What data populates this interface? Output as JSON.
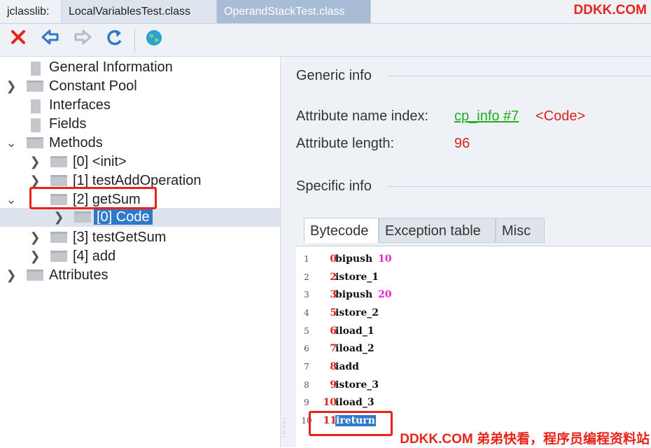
{
  "tabs": {
    "app_label": "jclasslib:",
    "items": [
      "LocalVariablesTest.class",
      "OperandStackTest.class"
    ]
  },
  "watermark_top": "DDKK.COM",
  "watermark_bottom": "DDKK.COM 弟弟快看，程序员编程资料站",
  "toolbar": {
    "icons": [
      "close-icon",
      "back-icon",
      "forward-icon",
      "reload-icon",
      "web-icon"
    ],
    "colors": {
      "close": "#e8231a",
      "back": "#2f79c8",
      "forward": "#b5bcc6",
      "reload": "#2f79c8",
      "web": "#2a9fd8"
    }
  },
  "tree": {
    "general_information": "General Information",
    "constant_pool": "Constant Pool",
    "interfaces": "Interfaces",
    "fields": "Fields",
    "methods": "Methods",
    "method_items": [
      "[0] <init>",
      "[1] testAddOperation",
      "[2] getSum",
      "[3] testGetSum",
      "[4] add"
    ],
    "code_item": "[0] Code",
    "attributes": "Attributes"
  },
  "generic_info": {
    "title": "Generic info",
    "name_index_label": "Attribute name index:",
    "name_index_link": "cp_info #7",
    "name_index_value": "<Code>",
    "length_label": "Attribute length:",
    "length_value": "96"
  },
  "specific_info": {
    "title": "Specific info",
    "tabs": [
      "Bytecode",
      "Exception table",
      "Misc"
    ]
  },
  "bytecode": [
    {
      "line": "1",
      "offset": "0",
      "op": "bipush",
      "arg": "10"
    },
    {
      "line": "2",
      "offset": "2",
      "op": "istore_1",
      "arg": ""
    },
    {
      "line": "3",
      "offset": "3",
      "op": "bipush",
      "arg": "20"
    },
    {
      "line": "4",
      "offset": "5",
      "op": "istore_2",
      "arg": ""
    },
    {
      "line": "5",
      "offset": "6",
      "op": "iload_1",
      "arg": ""
    },
    {
      "line": "6",
      "offset": "7",
      "op": "iload_2",
      "arg": ""
    },
    {
      "line": "7",
      "offset": "8",
      "op": "iadd",
      "arg": ""
    },
    {
      "line": "8",
      "offset": "9",
      "op": "istore_3",
      "arg": ""
    },
    {
      "line": "9",
      "offset": "10",
      "op": "iload_3",
      "arg": ""
    },
    {
      "line": "10",
      "offset": "11",
      "op": "ireturn",
      "arg": ""
    }
  ],
  "colors": {
    "selection": "#2f79c8",
    "highlight_box": "#e8231a",
    "link": "#22aa22",
    "value": "#d9231e",
    "argument": "#ee22cc"
  }
}
